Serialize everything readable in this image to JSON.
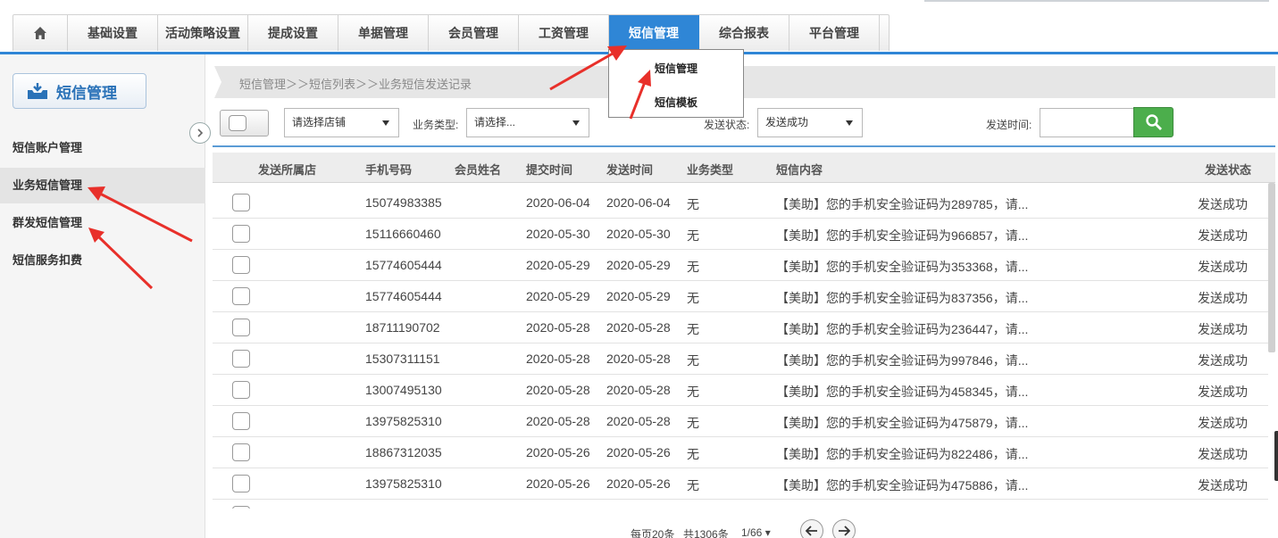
{
  "nav": {
    "items": [
      "基础设置",
      "活动策略设置",
      "提成设置",
      "单据管理",
      "会员管理",
      "工资管理",
      "短信管理",
      "综合报表",
      "平台管理"
    ],
    "active_index": 6
  },
  "dropdown": {
    "items": [
      "短信管理",
      "短信模板"
    ]
  },
  "sidebar": {
    "title": "短信管理",
    "items": [
      "短信账户管理",
      "业务短信管理",
      "群发短信管理",
      "短信服务扣费"
    ],
    "active_index": 1
  },
  "breadcrumb": "短信管理＞＞短信列表＞＞业务短信发送记录",
  "filters": {
    "store_select": "请选择店铺",
    "biz_type_label": "业务类型:",
    "biz_type_select": "请选择...",
    "send_status_label": "发送状态:",
    "send_status_select": "发送成功",
    "send_time_label": "发送时间:"
  },
  "table": {
    "headers": [
      "发送所属店",
      "手机号码",
      "会员姓名",
      "提交时间",
      "发送时间",
      "业务类型",
      "短信内容",
      "发送状态"
    ],
    "rows": [
      {
        "phone": "15074983385",
        "submit": "2020-06-04",
        "send": "2020-06-04",
        "type": "无",
        "content": "【美助】您的手机安全验证码为289785，请...",
        "status": "发送成功"
      },
      {
        "phone": "15116660460",
        "submit": "2020-05-30",
        "send": "2020-05-30",
        "type": "无",
        "content": "【美助】您的手机安全验证码为966857，请...",
        "status": "发送成功"
      },
      {
        "phone": "15774605444",
        "submit": "2020-05-29",
        "send": "2020-05-29",
        "type": "无",
        "content": "【美助】您的手机安全验证码为353368，请...",
        "status": "发送成功"
      },
      {
        "phone": "15774605444",
        "submit": "2020-05-29",
        "send": "2020-05-29",
        "type": "无",
        "content": "【美助】您的手机安全验证码为837356，请...",
        "status": "发送成功"
      },
      {
        "phone": "18711190702",
        "submit": "2020-05-28",
        "send": "2020-05-28",
        "type": "无",
        "content": "【美助】您的手机安全验证码为236447，请...",
        "status": "发送成功"
      },
      {
        "phone": "15307311151",
        "submit": "2020-05-28",
        "send": "2020-05-28",
        "type": "无",
        "content": "【美助】您的手机安全验证码为997846，请...",
        "status": "发送成功"
      },
      {
        "phone": "13007495130",
        "submit": "2020-05-28",
        "send": "2020-05-28",
        "type": "无",
        "content": "【美助】您的手机安全验证码为458345，请...",
        "status": "发送成功"
      },
      {
        "phone": "13975825310",
        "submit": "2020-05-28",
        "send": "2020-05-28",
        "type": "无",
        "content": "【美助】您的手机安全验证码为475879，请...",
        "status": "发送成功"
      },
      {
        "phone": "18867312035",
        "submit": "2020-05-26",
        "send": "2020-05-26",
        "type": "无",
        "content": "【美助】您的手机安全验证码为822486，请...",
        "status": "发送成功"
      },
      {
        "phone": "13975825310",
        "submit": "2020-05-26",
        "send": "2020-05-26",
        "type": "无",
        "content": "【美助】您的手机安全验证码为475886，请...",
        "status": "发送成功"
      }
    ]
  },
  "pager": {
    "per_page": "每页20条",
    "total": "共1306条",
    "page": "1/66 ▾"
  },
  "colors": {
    "accent": "#2f86d6",
    "search_green": "#4cae4c",
    "annotation_red": "#e8302a"
  }
}
